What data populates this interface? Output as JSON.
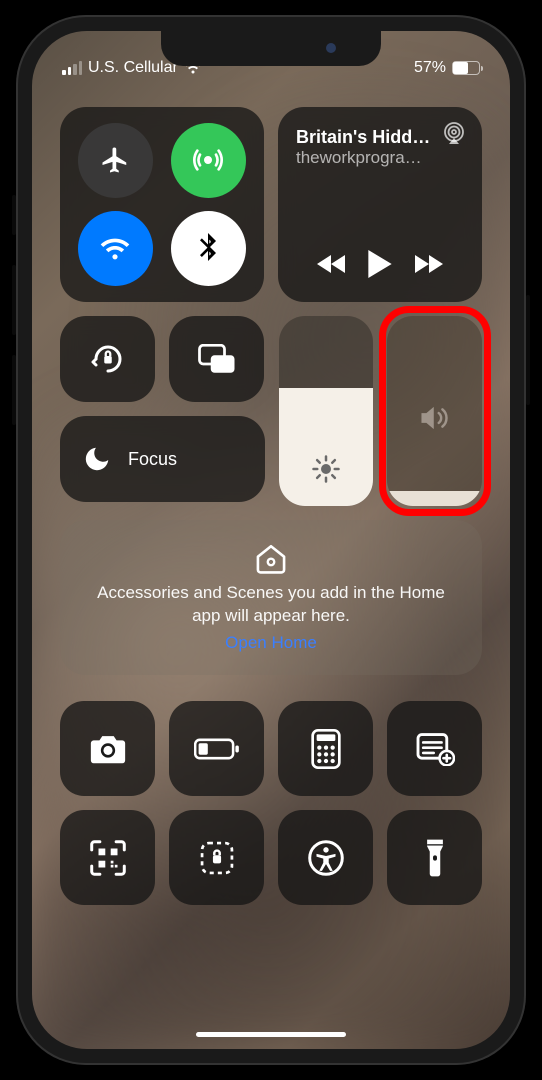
{
  "status": {
    "carrier": "U.S. Cellular",
    "battery_percent": "57%"
  },
  "media": {
    "title": "Britain's Hidd…",
    "subtitle": "theworkprogra…"
  },
  "focus": {
    "label": "Focus"
  },
  "brightness": {
    "level_percent": 62
  },
  "volume": {
    "level_percent": 8
  },
  "home": {
    "message": "Accessories and Scenes you add in the Home app will appear here.",
    "link_label": "Open Home"
  }
}
